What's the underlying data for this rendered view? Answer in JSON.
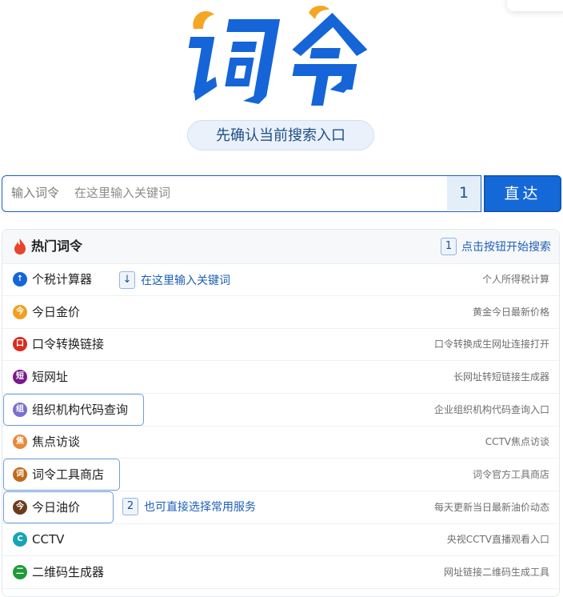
{
  "logo": {
    "text": "词令",
    "colors": {
      "primary": "#1565d8",
      "accent": "#f5a623"
    }
  },
  "confirm_pill": {
    "label": "先确认当前搜索入口"
  },
  "search": {
    "prefix": "输入词令",
    "placeholder": "在这里输入关键词",
    "step_number": "1",
    "button_label": "直达"
  },
  "panel": {
    "title": "热门词令",
    "head_hint": {
      "number": "1",
      "text": "点击按钮开始搜索"
    }
  },
  "hints": {
    "input_hint": {
      "arrow": "↓",
      "text": "在这里输入关键词"
    },
    "service_hint": {
      "number": "2",
      "text": "也可直接选择常用服务"
    }
  },
  "items": [
    {
      "icon": "arrow-up-icon",
      "glyph": "↑",
      "color": "#1565d8",
      "name": "个税计算器",
      "desc": "个人所得税计算"
    },
    {
      "icon": "gold-icon",
      "glyph": "今",
      "color": "#f0a020",
      "name": "今日金价",
      "desc": "黄金今日最新价格"
    },
    {
      "icon": "password-icon",
      "glyph": "口",
      "color": "#d92d20",
      "name": "口令转换链接",
      "desc": "口令转换成生网址连接打开"
    },
    {
      "icon": "short-url-icon",
      "glyph": "短",
      "color": "#7a1a8a",
      "name": "短网址",
      "desc": "长网址转短链接生成器"
    },
    {
      "icon": "org-code-icon",
      "glyph": "组",
      "color": "#7b6fd0",
      "name": "组织机构代码查询",
      "desc": "企业组织机构代码查询入口"
    },
    {
      "icon": "focus-icon",
      "glyph": "焦",
      "color": "#e8883a",
      "name": "焦点访谈",
      "desc": "CCTV焦点访谈"
    },
    {
      "icon": "tool-store-icon",
      "glyph": "词",
      "color": "#c26a1c",
      "name": "词令工具商店",
      "desc": "词令官方工具商店"
    },
    {
      "icon": "oil-icon",
      "glyph": "今",
      "color": "#6b3b1e",
      "name": "今日油价",
      "desc": "每天更新当日最新油价动态"
    },
    {
      "icon": "cctv-icon",
      "glyph": "C",
      "color": "#17a5b5",
      "name": "CCTV",
      "desc": "央视CCTV直播观看入口"
    },
    {
      "icon": "qr-code-icon",
      "glyph": "二",
      "color": "#1f9a3a",
      "name": "二维码生成器",
      "desc": "网址链接二维码生成工具"
    }
  ]
}
